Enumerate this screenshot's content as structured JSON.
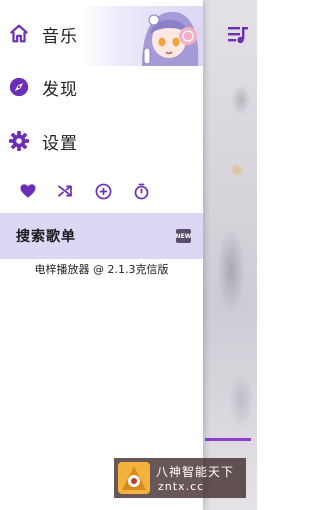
{
  "drawer": {
    "nav": [
      {
        "label": "音乐",
        "icon": "home-icon"
      },
      {
        "label": "发现",
        "icon": "compass-icon"
      },
      {
        "label": "设置",
        "icon": "gear-icon"
      }
    ],
    "actions": [
      "heart-icon",
      "shuffle-icon",
      "add-circle-icon",
      "timer-icon"
    ],
    "search": {
      "label": "搜索歌单",
      "badge": "NEW"
    },
    "version": "电梓播放器 @ 2.1.3克信版"
  },
  "watermark": {
    "line1": "八神智能天下",
    "line2": "zntx.cc"
  },
  "colors": {
    "accent": "#6b2fb6",
    "search_bg": "#ddd6f5",
    "badge_bg": "#5a4e6a"
  }
}
